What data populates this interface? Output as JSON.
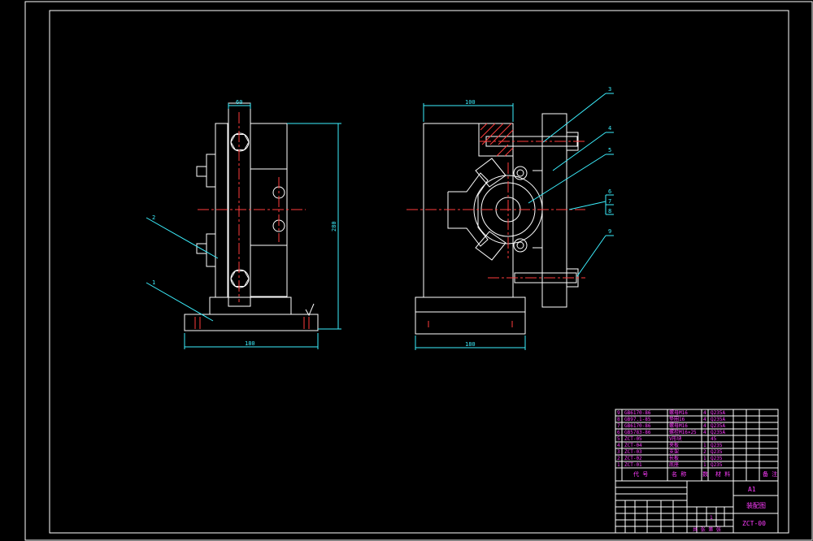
{
  "drawing": {
    "left_view": {
      "dim_top": "60",
      "dim_bottom": "180",
      "dim_height": "280",
      "balloons": [
        "2",
        "1"
      ]
    },
    "right_view": {
      "dim_top": "100",
      "dim_bottom": "180",
      "balloons": [
        "3",
        "4",
        "5",
        "6",
        "7",
        "8",
        "9"
      ]
    }
  },
  "parts_list": {
    "rows": [
      {
        "no": "9",
        "code": "GB6170-86",
        "name": "螺母M16",
        "qty": "4",
        "material": "Q235A"
      },
      {
        "no": "8",
        "code": "GB97.1-85",
        "name": "垫圈16",
        "qty": "4",
        "material": "Q235A"
      },
      {
        "no": "7",
        "code": "GB6170-86",
        "name": "螺母M16",
        "qty": "4",
        "material": "Q235A"
      },
      {
        "no": "6",
        "code": "GB5783-86",
        "name": "螺栓M16×25",
        "qty": "4",
        "material": "Q235A"
      },
      {
        "no": "5",
        "code": "ZCT-05",
        "name": "V形块",
        "qty": "",
        "material": "45"
      },
      {
        "no": "4",
        "code": "ZCT-04",
        "name": "夹板",
        "qty": "1",
        "material": "Q235"
      },
      {
        "no": "3",
        "code": "ZCT-03",
        "name": "支架",
        "qty": "2",
        "material": "Q235"
      },
      {
        "no": "2",
        "code": "ZCT-02",
        "name": "长板",
        "qty": "1",
        "material": "Q235"
      },
      {
        "no": "1",
        "code": "ZCT-01",
        "name": "底座",
        "qty": "1",
        "material": "Q235"
      }
    ],
    "header": {
      "code": "代 号",
      "name": "名 称",
      "qty": "数",
      "material": "材 料",
      "remark": "备 注"
    }
  },
  "title_block": {
    "sheet_size": "A1",
    "drawing_title": "装配图",
    "drawing_number": "ZCT-00",
    "scale": "1",
    "sheets": "共 张 第 张"
  }
}
